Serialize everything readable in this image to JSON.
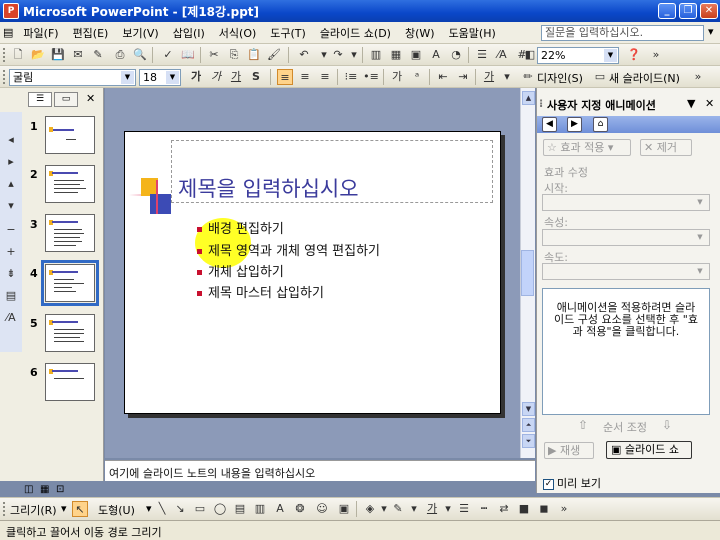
{
  "window": {
    "title": "Microsoft PowerPoint - [제18강.ppt]"
  },
  "menu": {
    "items": [
      "파일(F)",
      "편집(E)",
      "보기(V)",
      "삽입(I)",
      "서식(O)",
      "도구(T)",
      "슬라이드 쇼(D)",
      "창(W)",
      "도움말(H)"
    ],
    "help_placeholder": "질문을 입력하십시오."
  },
  "standard_toolbar": {
    "zoom": "22%"
  },
  "format_toolbar": {
    "font": "굴림",
    "size": "18",
    "bold": "가",
    "italic": "가",
    "underline": "가",
    "shadow": "S",
    "design_button": "디자인(S)",
    "new_slide_button": "새 슬라이드(N)"
  },
  "slides_panel": {
    "slides": [
      {
        "number": "1",
        "selected": false
      },
      {
        "number": "2",
        "selected": false
      },
      {
        "number": "3",
        "selected": false
      },
      {
        "number": "4",
        "selected": true
      },
      {
        "number": "5",
        "selected": false
      },
      {
        "number": "6",
        "selected": false
      }
    ]
  },
  "slide": {
    "title": "제목을 입력하십시오",
    "bullets": [
      "배경 편집하기",
      "제목 영역과 개체 영역 편집하기",
      "개체 삽입하기",
      "제목 마스터 삽입하기"
    ]
  },
  "notes": {
    "text": "여기에 슬라이드 노트의 내용을 입력하십시오"
  },
  "task_pane": {
    "title": "사용자 지정 애니메이션",
    "add_effect": "효과 적용",
    "remove": "제거",
    "modify_label": "효과 수정",
    "start_label": "시작:",
    "property_label": "속성:",
    "speed_label": "속도:",
    "list_message": "애니메이션을 적용하려면 슬라이드 구성 요소를 선택한 후 \"효과 적용\"을 클릭합니다.",
    "reorder_label": "순서 조정",
    "play_button": "재생",
    "slideshow_button": "슬라이드 쇼",
    "preview_label": "미리 보기",
    "preview_checked": true
  },
  "draw_toolbar": {
    "draw_menu": "그리기(R)",
    "autoshapes_menu": "도형(U)"
  },
  "status_bar": {
    "text": "클릭하고 끌어서 이동 경로 그리기"
  }
}
